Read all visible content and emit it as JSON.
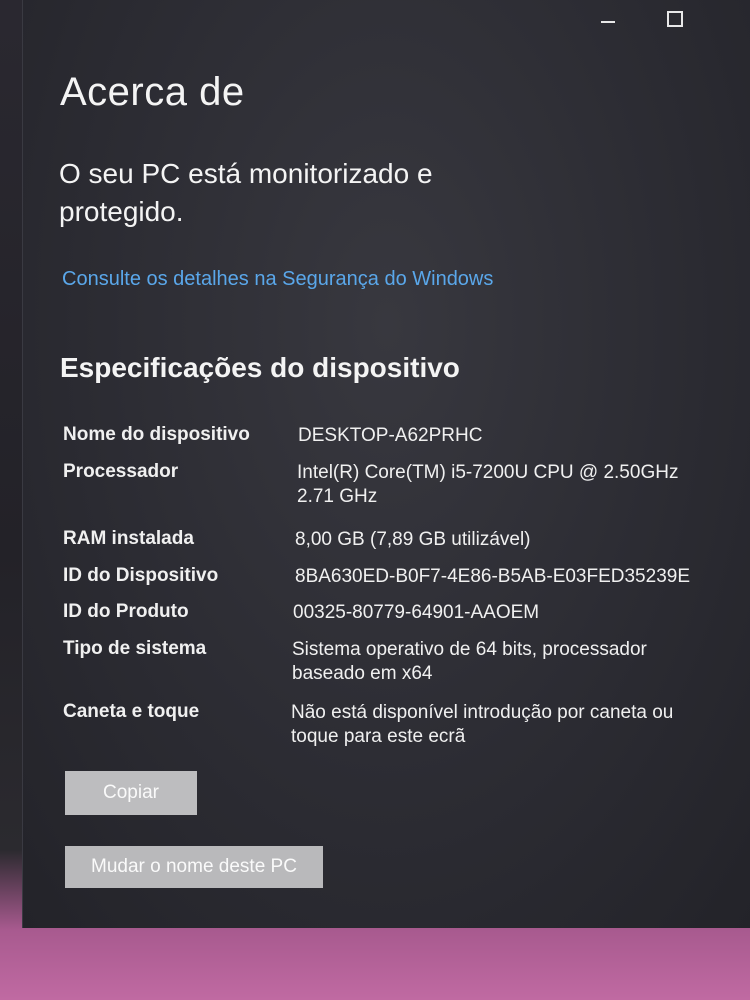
{
  "window": {
    "title": "Acerca de",
    "minimize_glyph": "minimize-icon",
    "maximize_glyph": "maximize-icon"
  },
  "security": {
    "status": "O seu PC está monitorizado e protegido.",
    "link": "Consulte os detalhes na Segurança do Windows"
  },
  "specs": {
    "heading": "Especificações do dispositivo",
    "rows": [
      {
        "label": "Nome do dispositivo",
        "value": "DESKTOP-A62PRHC"
      },
      {
        "label": "Processador",
        "value": "Intel(R) Core(TM) i5-7200U CPU @ 2.50GHz 2.71 GHz"
      },
      {
        "label": "RAM instalada",
        "value": "8,00 GB (7,89 GB utilizável)"
      },
      {
        "label": "ID do Dispositivo",
        "value": "8BA630ED-B0F7-4E86-B5AB-E03FED35239E"
      },
      {
        "label": "ID do Produto",
        "value": "00325-80779-64901-AAOEM"
      },
      {
        "label": "Tipo de sistema",
        "value": "Sistema operativo de 64 bits, processador baseado em x64"
      },
      {
        "label": "Caneta e toque",
        "value": "Não está disponível introdução por caneta ou toque para este ecrã"
      }
    ]
  },
  "buttons": {
    "copy": "Copiar",
    "rename": "Mudar o nome deste PC"
  },
  "colors": {
    "link": "#5aa7ea",
    "background": "#2c2c33"
  }
}
